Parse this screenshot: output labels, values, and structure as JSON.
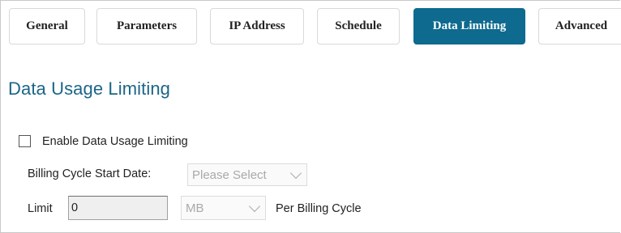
{
  "tabs": [
    {
      "label": "General",
      "active": false
    },
    {
      "label": "Parameters",
      "active": false
    },
    {
      "label": "IP Address",
      "active": false
    },
    {
      "label": "Schedule",
      "active": false
    },
    {
      "label": "Data Limiting",
      "active": true
    },
    {
      "label": "Advanced",
      "active": false
    }
  ],
  "section": {
    "title": "Data Usage Limiting"
  },
  "enable_limiting": {
    "label": "Enable Data Usage Limiting",
    "checked": false
  },
  "billing_cycle": {
    "label": "Billing Cycle Start Date:",
    "selected": "Please Select"
  },
  "limit": {
    "label": "Limit",
    "value": "0",
    "unit_selected": "MB",
    "suffix": "Per Billing Cycle"
  },
  "colors": {
    "accent": "#0e6a8e",
    "title": "#1b6588"
  }
}
